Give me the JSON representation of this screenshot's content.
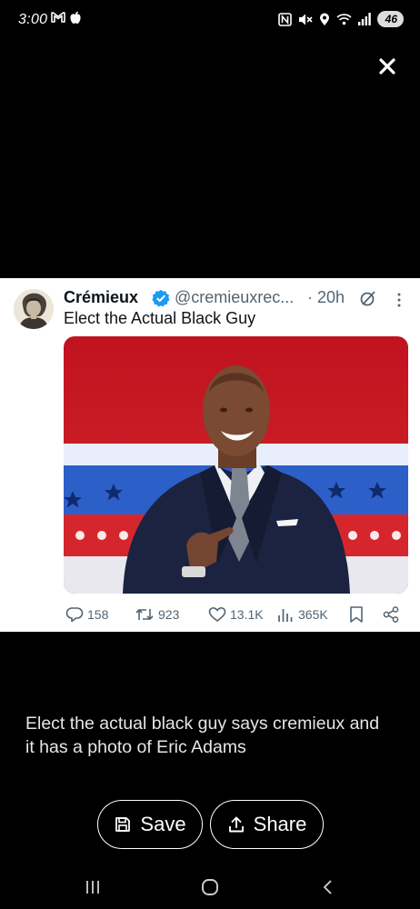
{
  "status_bar": {
    "time": "3:00",
    "left_icons": [
      "gmail-icon",
      "apple-icon"
    ],
    "right_icons": [
      "nfc-icon",
      "mute-icon",
      "location-icon",
      "wifi-icon",
      "signal-icon"
    ],
    "battery": "46"
  },
  "viewer": {
    "close_icon": "close-icon"
  },
  "tweet": {
    "display_name": "Crémieux",
    "handle": "@cremieuxrec...",
    "separator": "·",
    "age": "20h",
    "text": "Elect the Actual Black Guy",
    "actions": {
      "replies": "158",
      "reposts": "923",
      "likes": "13.1K",
      "views": "365K"
    },
    "colors": {
      "verified": "#1d9bf0",
      "muted": "#536471"
    }
  },
  "caption": "Elect the actual black guy says cremieux and it has a photo of Eric Adams",
  "buttons": {
    "save_label": "Save",
    "share_label": "Share"
  },
  "nav": [
    "recents-icon",
    "home-icon",
    "back-icon"
  ]
}
